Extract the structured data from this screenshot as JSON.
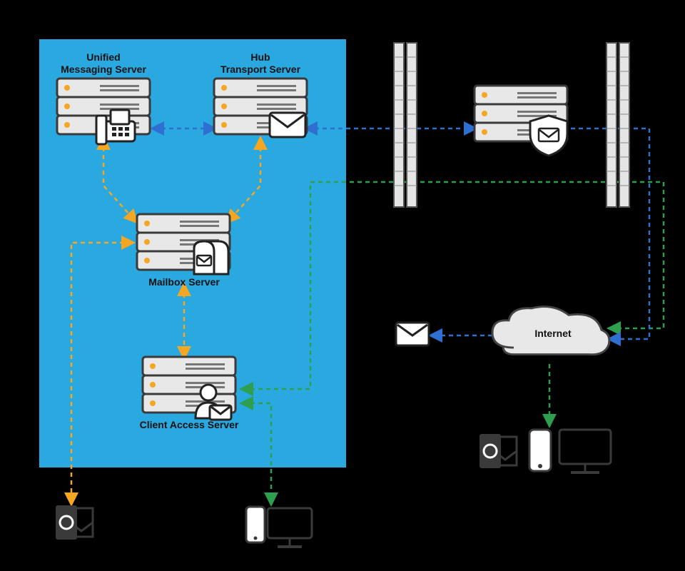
{
  "boxLabels": {
    "unifiedMessaging1": "Unified",
    "unifiedMessaging2": "Messaging Server",
    "hubTransport1": "Hub",
    "hubTransport2": "Transport Server",
    "mailbox": "Mailbox Server",
    "clientAccess": "Client Access Server",
    "internet": "Internet"
  },
  "colors": {
    "panel": "#2AA8E0",
    "serverFill": "#E8E8E8",
    "serverStroke": "#3A3A3A",
    "amber": "#F5A623",
    "lineOrange": "#F5A623",
    "lineGreen": "#2E9E4F",
    "lineBlue": "#2E6FD1",
    "wallFill": "#E5E5E5",
    "wallStroke": "#555555",
    "cloudFill": "#E8E8E8",
    "cloudStroke": "#444444"
  },
  "nodes": [
    {
      "id": "unified_messaging_server",
      "type": "server",
      "label_lines": [
        "Unified",
        "Messaging Server"
      ],
      "overlay": "fax"
    },
    {
      "id": "hub_transport_server",
      "type": "server",
      "label_lines": [
        "Hub",
        "Transport Server"
      ],
      "overlay": "envelope"
    },
    {
      "id": "mailbox_server",
      "type": "server",
      "label_lines": [
        "Mailbox Server"
      ],
      "overlay": "mailbox"
    },
    {
      "id": "client_access_server",
      "type": "server",
      "label_lines": [
        "Client Access Server"
      ],
      "overlay": "user_envelope"
    },
    {
      "id": "edge_transport_server",
      "type": "server",
      "label_lines": [],
      "overlay": "shield_envelope"
    },
    {
      "id": "firewall_inner",
      "type": "firewall"
    },
    {
      "id": "firewall_outer",
      "type": "firewall"
    },
    {
      "id": "internet_cloud",
      "type": "cloud",
      "label": "Internet"
    },
    {
      "id": "internal_outlook_client",
      "type": "outlook_icon"
    },
    {
      "id": "internal_mobile_desktop",
      "type": "device_group"
    },
    {
      "id": "external_envelope",
      "type": "envelope"
    },
    {
      "id": "external_clients",
      "type": "device_group_with_outlook"
    }
  ],
  "edges": [
    {
      "from": "unified_messaging_server",
      "to": "mailbox_server",
      "color": "orange",
      "style": "dashed",
      "arrows": "both"
    },
    {
      "from": "hub_transport_server",
      "to": "mailbox_server",
      "color": "orange",
      "style": "dashed",
      "arrows": "both"
    },
    {
      "from": "unified_messaging_server",
      "to": "hub_transport_server",
      "color": "blue",
      "style": "dashed",
      "arrows": "both"
    },
    {
      "from": "mailbox_server",
      "to": "client_access_server",
      "color": "orange",
      "style": "dashed",
      "arrows": "both"
    },
    {
      "from": "mailbox_server",
      "to": "internal_outlook_client",
      "color": "orange",
      "style": "dashed",
      "arrows": "both"
    },
    {
      "from": "client_access_server",
      "to": "internal_mobile_desktop",
      "color": "green",
      "style": "dashed",
      "arrows": "both"
    },
    {
      "from": "client_access_server",
      "to": "firewall_inner",
      "color": "green",
      "style": "dashed",
      "arrows": "end",
      "via": "hub_transport_level"
    },
    {
      "from": "firewall_inner",
      "to": "firewall_outer",
      "color": "green",
      "style": "dashed",
      "arrows": "none"
    },
    {
      "from": "firewall_outer",
      "to": "internet_cloud",
      "color": "green",
      "style": "dashed",
      "arrows": "end"
    },
    {
      "from": "internet_cloud",
      "to": "external_clients",
      "color": "green",
      "style": "dashed",
      "arrows": "end"
    },
    {
      "from": "hub_transport_server",
      "to": "edge_transport_server",
      "color": "blue",
      "style": "dashed",
      "arrows": "both",
      "through": [
        "firewall_inner"
      ]
    },
    {
      "from": "edge_transport_server",
      "to": "internet_cloud",
      "color": "blue",
      "style": "dashed",
      "arrows": "end",
      "through": [
        "firewall_outer"
      ]
    },
    {
      "from": "internet_cloud",
      "to": "external_envelope",
      "color": "blue",
      "style": "dashed",
      "arrows": "end"
    }
  ]
}
